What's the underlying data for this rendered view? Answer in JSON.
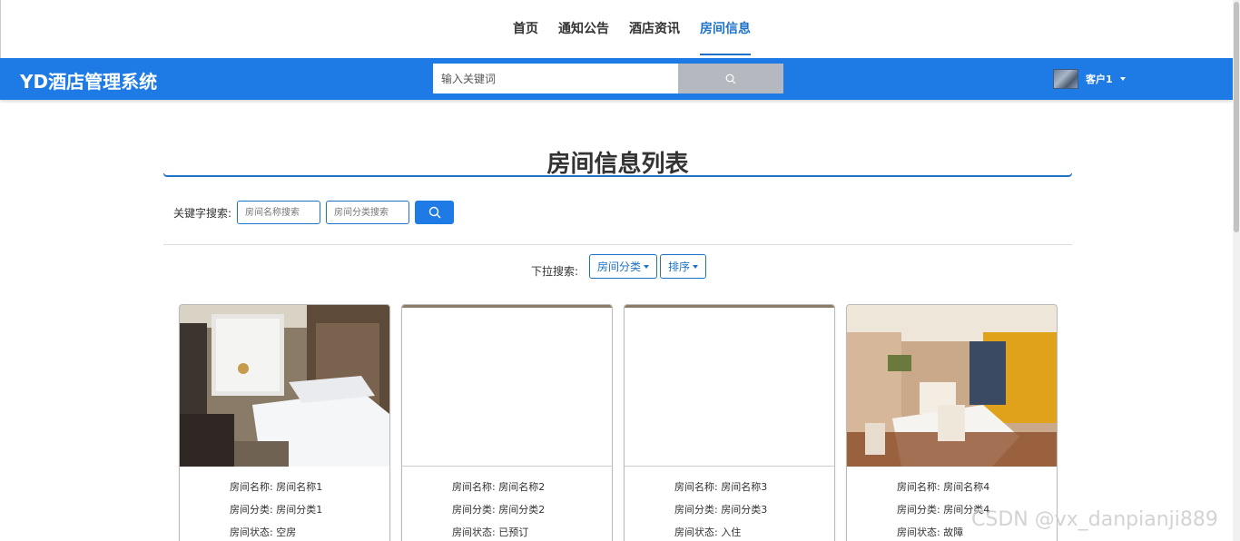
{
  "nav": {
    "items": [
      {
        "label": "首页"
      },
      {
        "label": "通知公告"
      },
      {
        "label": "酒店资讯"
      },
      {
        "label": "房间信息"
      }
    ]
  },
  "header": {
    "brand": "YD酒店管理系统",
    "search_placeholder": "输入关键词",
    "user_name": "客户1"
  },
  "main": {
    "title": "房间信息列表",
    "keyword_label": "关键字搜索:",
    "name_placeholder": "房间名称搜索",
    "category_placeholder": "房间分类搜索",
    "dropdown_label": "下拉搜索:",
    "category_dropdown": "房间分类",
    "sort_dropdown": "排序"
  },
  "rooms": [
    {
      "name": "房间名称: 房间名称1",
      "category": "房间分类: 房间分类1",
      "status": "房间状态: 空房"
    },
    {
      "name": "房间名称: 房间名称2",
      "category": "房间分类: 房间分类2",
      "status": "房间状态: 已预订"
    },
    {
      "name": "房间名称: 房间名称3",
      "category": "房间分类: 房间分类3",
      "status": "房间状态: 入住"
    },
    {
      "name": "房间名称: 房间名称4",
      "category": "房间分类: 房间分类4",
      "status": "房间状态: 故障"
    }
  ],
  "watermark": "CSDN @vx_danpianji889",
  "colors": {
    "primary": "#1e7be6",
    "active_nav": "#1e73c9"
  }
}
